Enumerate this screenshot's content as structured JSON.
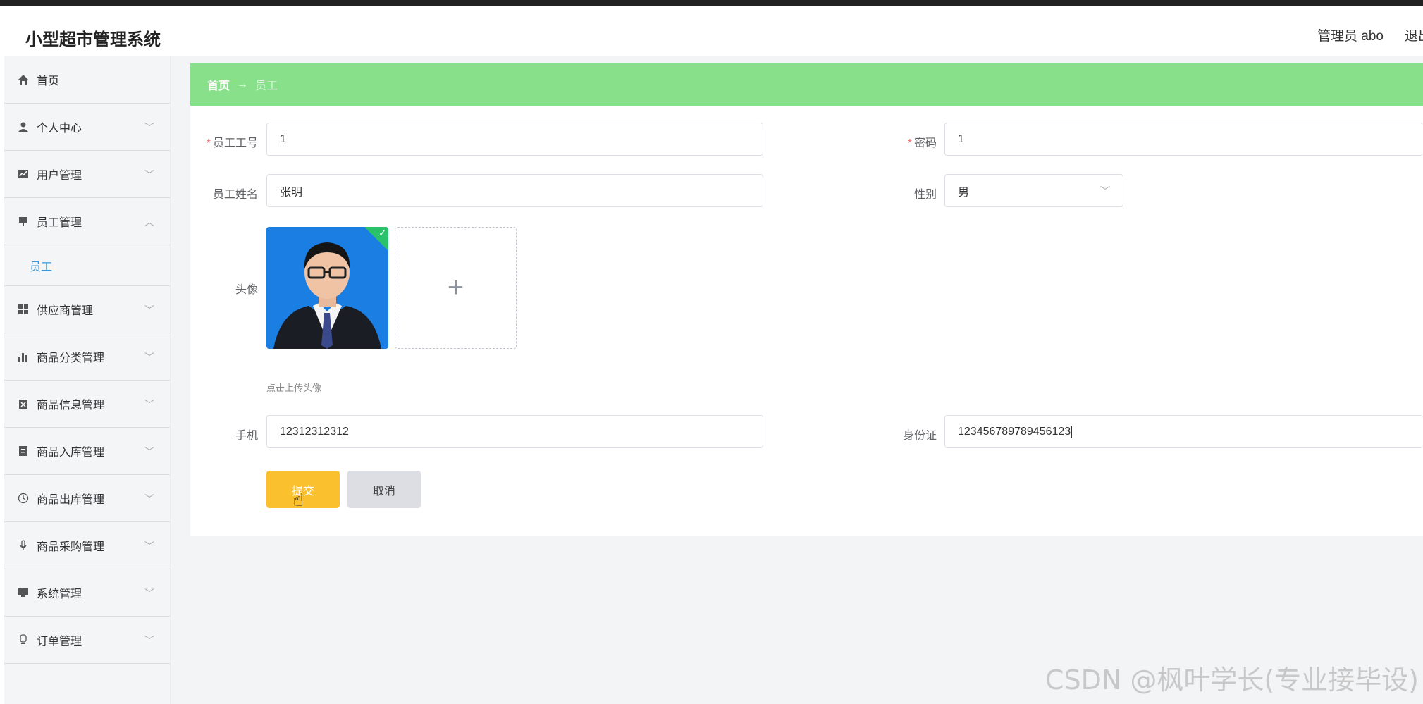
{
  "header": {
    "title": "小型超市管理系统",
    "user": "管理员 abo",
    "logout": "退出"
  },
  "sidebar": {
    "items": [
      {
        "label": "首页",
        "icon": "home-icon"
      },
      {
        "label": "个人中心",
        "icon": "user-icon"
      },
      {
        "label": "用户管理",
        "icon": "chart-icon"
      },
      {
        "label": "员工管理",
        "icon": "monitor-icon",
        "expanded": true
      },
      {
        "label": "员工",
        "submenu": true
      },
      {
        "label": "供应商管理",
        "icon": "grid-icon"
      },
      {
        "label": "商品分类管理",
        "icon": "bar-chart-icon"
      },
      {
        "label": "商品信息管理",
        "icon": "clipboard-icon"
      },
      {
        "label": "商品入库管理",
        "icon": "document-icon"
      },
      {
        "label": "商品出库管理",
        "icon": "clock-icon"
      },
      {
        "label": "商品采购管理",
        "icon": "microphone-icon"
      },
      {
        "label": "系统管理",
        "icon": "screen-icon"
      },
      {
        "label": "订单管理",
        "icon": "bulb-icon"
      }
    ]
  },
  "breadcrumb": {
    "home": "首页",
    "arrow": "→",
    "current": "员工"
  },
  "form": {
    "employee_no_label": "员工工号",
    "employee_no_value": "1",
    "password_label": "密码",
    "password_value": "1",
    "name_label": "员工姓名",
    "name_value": "张明",
    "gender_label": "性别",
    "gender_value": "男",
    "avatar_label": "头像",
    "upload_tip": "点击上传头像",
    "upload_plus": "+",
    "phone_label": "手机",
    "phone_value": "12312312312",
    "idcard_label": "身份证",
    "idcard_value": "123456789789456123",
    "submit_label": "提交",
    "cancel_label": "取消"
  },
  "watermark": "CSDN @枫叶学长(专业接毕设)",
  "colors": {
    "accent_green": "#88e08a",
    "submit_yellow": "#fbc02d",
    "link_blue": "#3a9ad9"
  }
}
